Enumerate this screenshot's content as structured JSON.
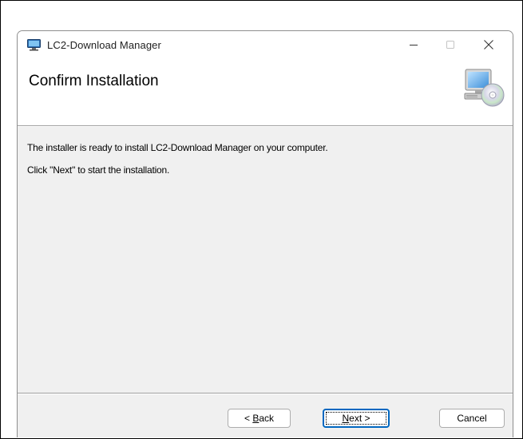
{
  "window": {
    "title": "LC2-Download Manager"
  },
  "banner": {
    "title": "Confirm Installation"
  },
  "content": {
    "line1": "The installer is ready to install LC2-Download Manager on your computer.",
    "line2": "Click \"Next\" to start the installation."
  },
  "buttons": {
    "back_prefix": "< ",
    "back_mnemonic": "B",
    "back_rest": "ack",
    "next_mnemonic": "N",
    "next_rest": "ext >",
    "cancel": "Cancel"
  },
  "colors": {
    "accent": "#0067c0",
    "dialog_bg": "#f0f0f0"
  },
  "icons": {
    "app": "installer-app-icon",
    "banner": "computer-cd-icon",
    "minimize": "minimize-icon",
    "maximize": "maximize-icon",
    "close": "close-icon"
  }
}
